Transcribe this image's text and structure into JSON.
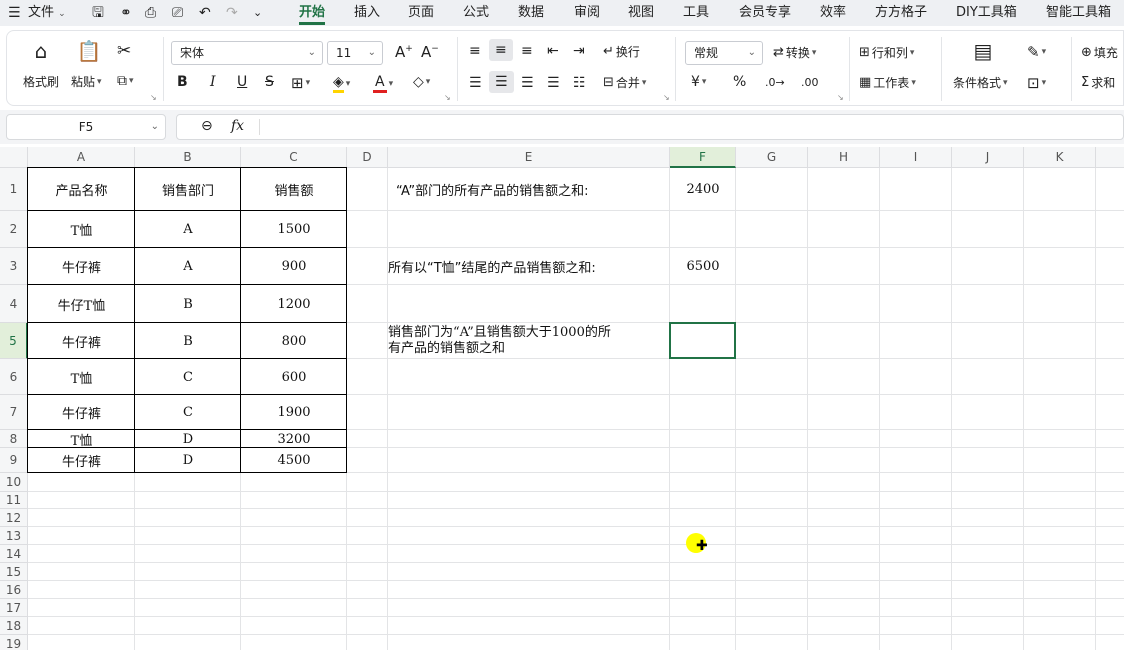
{
  "menu": {
    "file": "文件",
    "tabs": [
      "开始",
      "插入",
      "页面",
      "公式",
      "数据",
      "审阅",
      "视图",
      "工具",
      "会员专享",
      "效率",
      "方方格子",
      "DIY工具箱",
      "智能工具箱"
    ],
    "active_tab": "开始"
  },
  "ribbon": {
    "format_painter": "格式刷",
    "paste": "粘贴",
    "font_name": "宋体",
    "font_size": "11",
    "wrap": "换行",
    "merge": "合并",
    "number_format": "常规",
    "convert": "转换",
    "rows_cols": "行和列",
    "worksheet": "工作表",
    "conditional_format": "条件格式",
    "fill": "填充",
    "sum": "求和",
    "currency": "¥",
    "percent": "%",
    "bold": "B",
    "italic": "I",
    "underline": "U",
    "strike": "S",
    "font_color_letter": "A",
    "grow_font": "A",
    "shrink_font": "A"
  },
  "formula_bar": {
    "name_box": "F5",
    "fx": "fx",
    "formula": ""
  },
  "columns": [
    "A",
    "B",
    "C",
    "D",
    "E",
    "F",
    "G",
    "H",
    "I",
    "J",
    "K"
  ],
  "rows": [
    "1",
    "2",
    "3",
    "4",
    "5",
    "6",
    "7",
    "8",
    "9",
    "10",
    "11",
    "12",
    "13",
    "14",
    "15",
    "16",
    "17",
    "18",
    "19"
  ],
  "active_cell": {
    "column": "F",
    "row": "5"
  },
  "table": {
    "headers": [
      "产品名称",
      "销售部门",
      "销售额"
    ],
    "rows": [
      [
        "T恤",
        "A",
        "1500"
      ],
      [
        "牛仔裤",
        "A",
        "900"
      ],
      [
        "牛仔T恤",
        "B",
        "1200"
      ],
      [
        "牛仔裤",
        "B",
        "800"
      ],
      [
        "T恤",
        "C",
        "600"
      ],
      [
        "牛仔裤",
        "C",
        "1900"
      ],
      [
        "T恤",
        "D",
        "3200"
      ],
      [
        "牛仔裤",
        "D",
        "4500"
      ]
    ]
  },
  "questions": [
    {
      "label": "“A”部门的所有产品的销售额之和:",
      "answer": "2400"
    },
    {
      "label": "所有以“T恤”结尾的产品销售额之和:",
      "answer": "6500"
    },
    {
      "label_line1": "销售部门为“A”且销售额大于1000的所",
      "label_line2": "有产品的销售额之和",
      "answer": ""
    }
  ],
  "colors": {
    "accent": "#217346",
    "font_color": "#e02020",
    "cursor_highlight": "#ffff00"
  }
}
